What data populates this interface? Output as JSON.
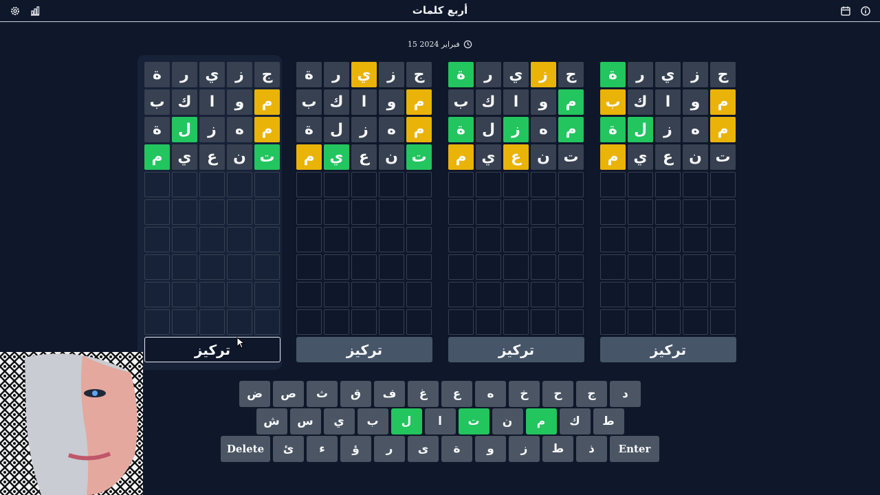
{
  "header": {
    "title": "أربع كلمات",
    "icons": [
      "settings-icon",
      "stats-icon",
      "calendar-icon",
      "info-icon"
    ]
  },
  "date": "15 فبراير 2024",
  "focus_label": "تركيز",
  "boards": [
    {
      "focused": true,
      "rows": [
        [
          [
            "ج",
            "gray"
          ],
          [
            "ز",
            "gray"
          ],
          [
            "ي",
            "gray"
          ],
          [
            "ر",
            "gray"
          ],
          [
            "ة",
            "gray"
          ]
        ],
        [
          [
            "م",
            "yellow"
          ],
          [
            "و",
            "gray"
          ],
          [
            "ا",
            "gray"
          ],
          [
            "ك",
            "gray"
          ],
          [
            "ب",
            "gray"
          ]
        ],
        [
          [
            "م",
            "yellow"
          ],
          [
            "ه",
            "gray"
          ],
          [
            "ز",
            "gray"
          ],
          [
            "ل",
            "green"
          ],
          [
            "ة",
            "gray"
          ]
        ],
        [
          [
            "ت",
            "green"
          ],
          [
            "ن",
            "gray"
          ],
          [
            "ع",
            "gray"
          ],
          [
            "ي",
            "gray"
          ],
          [
            "م",
            "green"
          ]
        ]
      ]
    },
    {
      "focused": false,
      "rows": [
        [
          [
            "ج",
            "gray"
          ],
          [
            "ز",
            "gray"
          ],
          [
            "ي",
            "yellow"
          ],
          [
            "ر",
            "gray"
          ],
          [
            "ة",
            "gray"
          ]
        ],
        [
          [
            "م",
            "yellow"
          ],
          [
            "و",
            "gray"
          ],
          [
            "ا",
            "gray"
          ],
          [
            "ك",
            "gray"
          ],
          [
            "ب",
            "gray"
          ]
        ],
        [
          [
            "م",
            "yellow"
          ],
          [
            "ه",
            "gray"
          ],
          [
            "ز",
            "gray"
          ],
          [
            "ل",
            "gray"
          ],
          [
            "ة",
            "gray"
          ]
        ],
        [
          [
            "ت",
            "green"
          ],
          [
            "ن",
            "gray"
          ],
          [
            "ع",
            "gray"
          ],
          [
            "ي",
            "green"
          ],
          [
            "م",
            "yellow"
          ]
        ]
      ]
    },
    {
      "focused": false,
      "rows": [
        [
          [
            "ج",
            "gray"
          ],
          [
            "ز",
            "yellow"
          ],
          [
            "ي",
            "gray"
          ],
          [
            "ر",
            "gray"
          ],
          [
            "ة",
            "green"
          ]
        ],
        [
          [
            "م",
            "green"
          ],
          [
            "و",
            "gray"
          ],
          [
            "ا",
            "gray"
          ],
          [
            "ك",
            "gray"
          ],
          [
            "ب",
            "gray"
          ]
        ],
        [
          [
            "م",
            "green"
          ],
          [
            "ه",
            "gray"
          ],
          [
            "ز",
            "green"
          ],
          [
            "ل",
            "gray"
          ],
          [
            "ة",
            "green"
          ]
        ],
        [
          [
            "ت",
            "gray"
          ],
          [
            "ن",
            "gray"
          ],
          [
            "ع",
            "yellow"
          ],
          [
            "ي",
            "gray"
          ],
          [
            "م",
            "yellow"
          ]
        ]
      ]
    },
    {
      "focused": false,
      "rows": [
        [
          [
            "ج",
            "gray"
          ],
          [
            "ز",
            "gray"
          ],
          [
            "ي",
            "gray"
          ],
          [
            "ر",
            "gray"
          ],
          [
            "ة",
            "green"
          ]
        ],
        [
          [
            "م",
            "yellow"
          ],
          [
            "و",
            "gray"
          ],
          [
            "ا",
            "gray"
          ],
          [
            "ك",
            "gray"
          ],
          [
            "ب",
            "yellow"
          ]
        ],
        [
          [
            "م",
            "yellow"
          ],
          [
            "ه",
            "gray"
          ],
          [
            "ز",
            "gray"
          ],
          [
            "ل",
            "green"
          ],
          [
            "ة",
            "green"
          ]
        ],
        [
          [
            "ت",
            "gray"
          ],
          [
            "ن",
            "gray"
          ],
          [
            "ع",
            "gray"
          ],
          [
            "ي",
            "gray"
          ],
          [
            "م",
            "yellow"
          ]
        ]
      ]
    }
  ],
  "total_rows": 10,
  "keyboard": [
    [
      [
        "د",
        "gray"
      ],
      [
        "ج",
        "gray"
      ],
      [
        "ح",
        "gray"
      ],
      [
        "خ",
        "gray"
      ],
      [
        "ه",
        "gray"
      ],
      [
        "ع",
        "gray"
      ],
      [
        "غ",
        "gray"
      ],
      [
        "ف",
        "gray"
      ],
      [
        "ق",
        "gray"
      ],
      [
        "ث",
        "gray"
      ],
      [
        "ص",
        "gray"
      ],
      [
        "ض",
        "gray"
      ]
    ],
    [
      [
        "ط",
        "gray"
      ],
      [
        "ك",
        "gray"
      ],
      [
        "م",
        "green"
      ],
      [
        "ن",
        "gray"
      ],
      [
        "ت",
        "green"
      ],
      [
        "ا",
        "gray"
      ],
      [
        "ل",
        "green"
      ],
      [
        "ب",
        "gray"
      ],
      [
        "ي",
        "gray"
      ],
      [
        "س",
        "gray"
      ],
      [
        "ش",
        "gray"
      ]
    ],
    [
      [
        "Enter",
        "wide"
      ],
      [
        "ذ",
        "gray"
      ],
      [
        "ط",
        "gray"
      ],
      [
        "ز",
        "gray"
      ],
      [
        "و",
        "gray"
      ],
      [
        "ة",
        "gray"
      ],
      [
        "ى",
        "gray"
      ],
      [
        "ر",
        "gray"
      ],
      [
        "ؤ",
        "gray"
      ],
      [
        "ء",
        "gray"
      ],
      [
        "ئ",
        "gray"
      ],
      [
        "Delete",
        "wide"
      ]
    ]
  ],
  "colors": {
    "background": "#0f172a",
    "tile": "#374151",
    "green": "#22c55e",
    "yellow": "#eab308"
  }
}
